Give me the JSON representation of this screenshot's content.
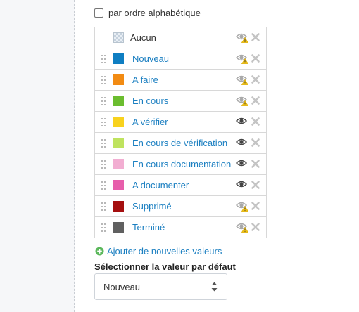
{
  "sort": {
    "label": "par ordre alphabétique",
    "checked": false
  },
  "values": [
    {
      "label": "Aucun",
      "color": null,
      "visible": false,
      "draggable": false,
      "is_link": false
    },
    {
      "label": "Nouveau",
      "color": "#0f7ec2",
      "visible": false,
      "draggable": true,
      "is_link": true
    },
    {
      "label": "A faire",
      "color": "#f28b13",
      "visible": false,
      "draggable": true,
      "is_link": true
    },
    {
      "label": "En cours",
      "color": "#6bbd2f",
      "visible": false,
      "draggable": true,
      "is_link": true
    },
    {
      "label": "A vérifier",
      "color": "#f8d21e",
      "visible": true,
      "draggable": true,
      "is_link": true
    },
    {
      "label": "En cours de vérification",
      "color": "#bfe35f",
      "visible": true,
      "draggable": true,
      "is_link": true
    },
    {
      "label": "En cours documentation",
      "color": "#f2aed2",
      "visible": true,
      "draggable": true,
      "is_link": true
    },
    {
      "label": "A documenter",
      "color": "#e75eab",
      "visible": true,
      "draggable": true,
      "is_link": true
    },
    {
      "label": "Supprimé",
      "color": "#a50f10",
      "visible": false,
      "draggable": true,
      "is_link": true
    },
    {
      "label": "Terminé",
      "color": "#606060",
      "visible": false,
      "draggable": true,
      "is_link": true
    }
  ],
  "add_values": {
    "label": "Ajouter de nouvelles valeurs",
    "icon": "plus-circle-icon",
    "icon_color": "#5cb85c"
  },
  "default_value": {
    "label": "Sélectionner la valeur par défaut",
    "selected": "Nouveau"
  },
  "colors": {
    "link": "#1b7fc1",
    "hidden_eye": "#a9a9a9",
    "visible_eye": "#444444",
    "warning_badge": "#f3c413"
  }
}
